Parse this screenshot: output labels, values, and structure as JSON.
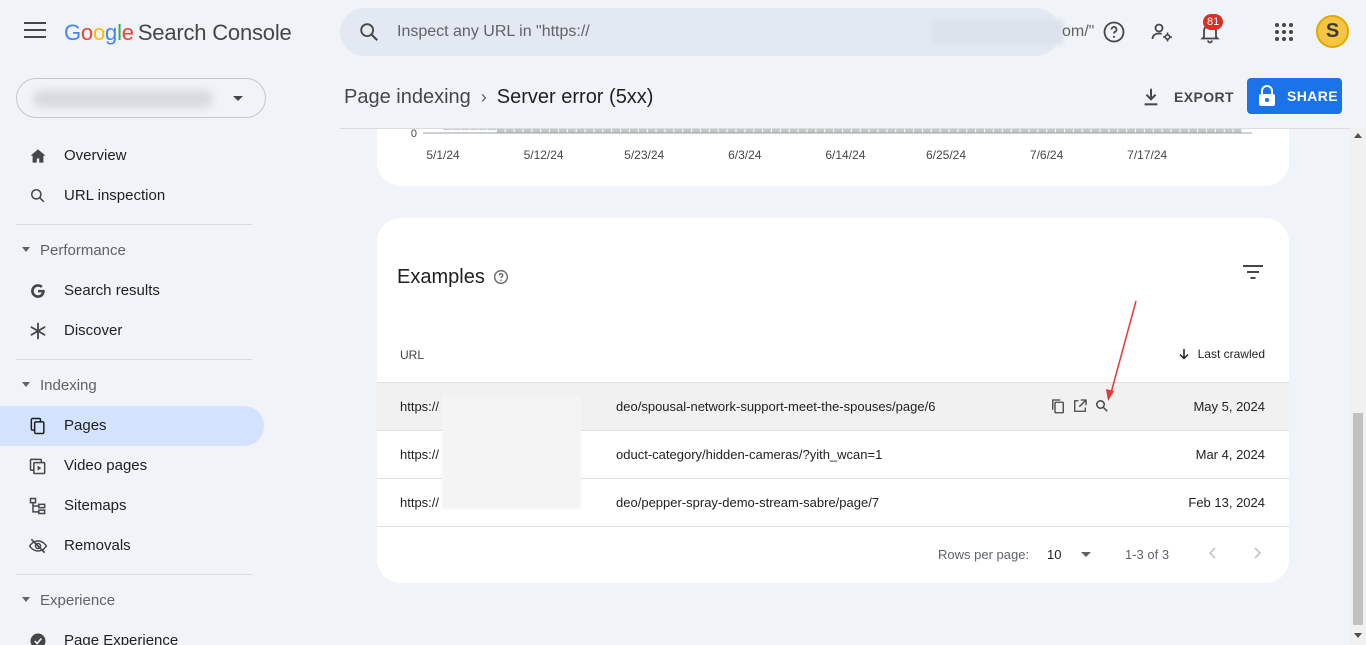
{
  "header": {
    "logo": {
      "G": "G",
      "o1": "o",
      "o2": "o",
      "g": "g",
      "l": "l",
      "e": "e",
      "product": "Search Console"
    },
    "search_placeholder": "Inspect any URL in \"https://",
    "search_placeholder_tail": "om/\"",
    "notification_count": "81",
    "avatar_letter": "S"
  },
  "sidebar": {
    "items": [
      {
        "label": "Overview",
        "icon": "home-icon"
      },
      {
        "label": "URL inspection",
        "icon": "search-icon"
      }
    ],
    "sections": [
      {
        "title": "Performance",
        "items": [
          {
            "label": "Search results",
            "icon": "google-g-icon"
          },
          {
            "label": "Discover",
            "icon": "asterisk-icon"
          }
        ]
      },
      {
        "title": "Indexing",
        "items": [
          {
            "label": "Pages",
            "icon": "pages-icon",
            "active": true
          },
          {
            "label": "Video pages",
            "icon": "video-icon"
          },
          {
            "label": "Sitemaps",
            "icon": "sitemap-icon"
          },
          {
            "label": "Removals",
            "icon": "eye-off-icon"
          }
        ]
      },
      {
        "title": "Experience",
        "items": [
          {
            "label": "Page Experience",
            "icon": "page-experience-icon"
          }
        ]
      }
    ]
  },
  "breadcrumb": {
    "parent": "Page indexing",
    "current": "Server error (5xx)"
  },
  "actions": {
    "export_label": "EXPORT",
    "share_label": "SHARE"
  },
  "chart_data": {
    "type": "bar",
    "y_tick_visible": "0",
    "x_ticks": [
      "5/1/24",
      "5/12/24",
      "5/23/24",
      "6/3/24",
      "6/14/24",
      "6/25/24",
      "7/6/24",
      "7/17/24"
    ]
  },
  "examples": {
    "title": "Examples",
    "columns": {
      "url": "URL",
      "last_crawled": "Last crawled"
    },
    "rows": [
      {
        "url_prefix": "https://",
        "url_suffix": "deo/spousal-network-support-meet-the-spouses/page/6",
        "date": "May 5, 2024"
      },
      {
        "url_prefix": "https://",
        "url_suffix": "oduct-category/hidden-cameras/?yith_wcan=1",
        "date": "Mar 4, 2024"
      },
      {
        "url_prefix": "https://",
        "url_suffix": "deo/pepper-spray-demo-stream-sabre/page/7",
        "date": "Feb 13, 2024"
      }
    ],
    "pager": {
      "rows_per_page_label": "Rows per page:",
      "rows_per_page_value": "10",
      "range": "1-3 of 3"
    }
  },
  "colors": {
    "accent": "#1a73e8",
    "active_nav": "#d3e3fd",
    "background": "#f0f4f9",
    "annotation_arrow": "#e53935"
  }
}
